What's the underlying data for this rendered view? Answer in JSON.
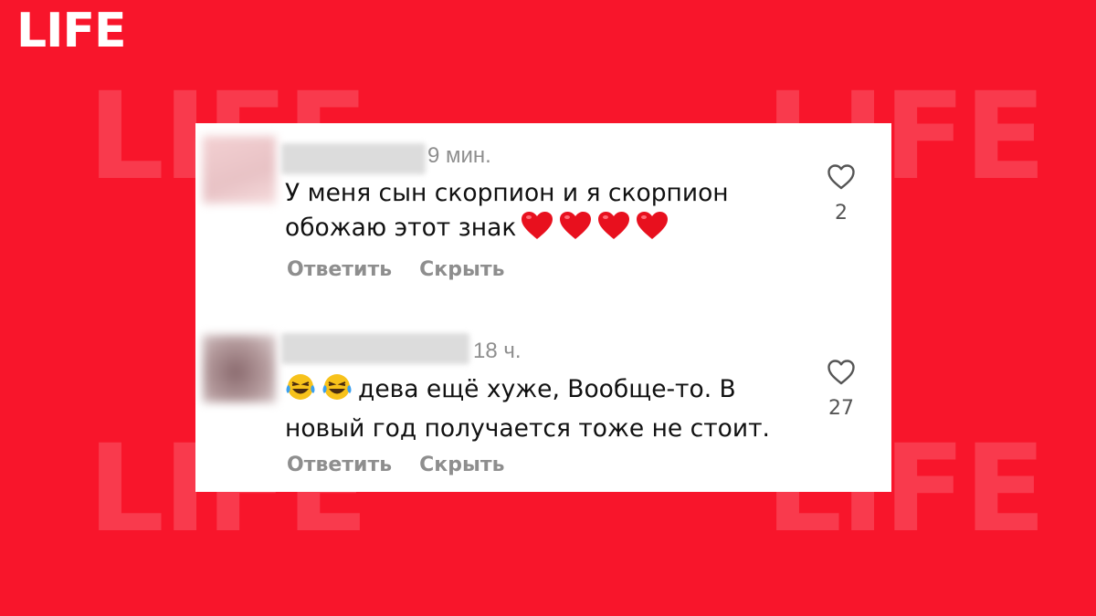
{
  "brand": {
    "logo": "LIFE",
    "watermark": "LIFE"
  },
  "comments": [
    {
      "time": "9 мин.",
      "text_line1": "У меня сын скорпион и я скорпион",
      "text_line2": "обожаю этот знак",
      "emoji_after": [
        "red-heart",
        "red-heart",
        "red-heart",
        "red-heart"
      ],
      "likes": "2",
      "reply_label": "Ответить",
      "hide_label": "Скрыть"
    },
    {
      "time": "18 ч.",
      "emoji_before": [
        "face-with-tears-of-joy",
        "face-with-tears-of-joy"
      ],
      "text_line1": "дева ещё хуже, Вообще-то. В",
      "text_line2": "новый год получается тоже не стоит.",
      "likes": "27",
      "reply_label": "Ответить",
      "hide_label": "Скрыть"
    }
  ],
  "colors": {
    "background": "#f8152b",
    "card": "#ffffff",
    "muted": "#8e8e8e",
    "heart": "#e8101e"
  }
}
